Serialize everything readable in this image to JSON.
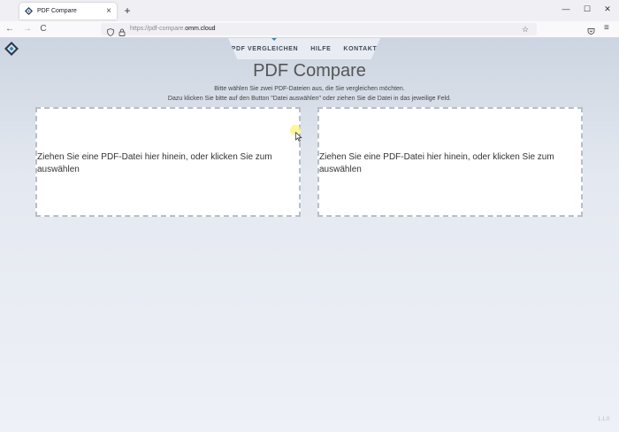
{
  "browser": {
    "tab_title": "PDF Compare",
    "tab_close": "×",
    "new_tab": "+",
    "url_prefix": "https://pdf-compare.",
    "url_domain": "omm.cloud",
    "back": "←",
    "forward": "→",
    "reload": "C",
    "bookmark_star": "☆",
    "menu": "≡",
    "minimize": "—",
    "maximize": "☐",
    "close": "✕"
  },
  "site": {
    "nav": [
      {
        "label": "PDF VERGLEICHEN"
      },
      {
        "label": "HILFE"
      },
      {
        "label": "KONTAKT"
      }
    ],
    "title": "PDF Compare",
    "intro_line1": "Bitte wählen Sie zwei PDF-Dateien aus, die Sie vergleichen möchten.",
    "intro_line2": "Dazu klicken Sie bitte auf den Button \"Datei auswählen\" oder ziehen Sie die Datei in das jeweilige Feld.",
    "dropzones": [
      {
        "text": "Ziehen Sie eine PDF-Datei hier hinein, oder klicken Sie zum auswählen"
      },
      {
        "text": "Ziehen Sie eine PDF-Datei hier hinein, oder klicken Sie zum auswählen"
      }
    ],
    "version": "1.1.0"
  },
  "colors": {
    "accent": "#2d87c9",
    "logo_dark": "#2b3a4f"
  },
  "icons": {
    "favicon": "diamond-logo-icon",
    "shield": "shield-icon",
    "lock": "lock-icon",
    "pocket": "pocket-icon",
    "cursor": "mouse-pointer-icon"
  }
}
